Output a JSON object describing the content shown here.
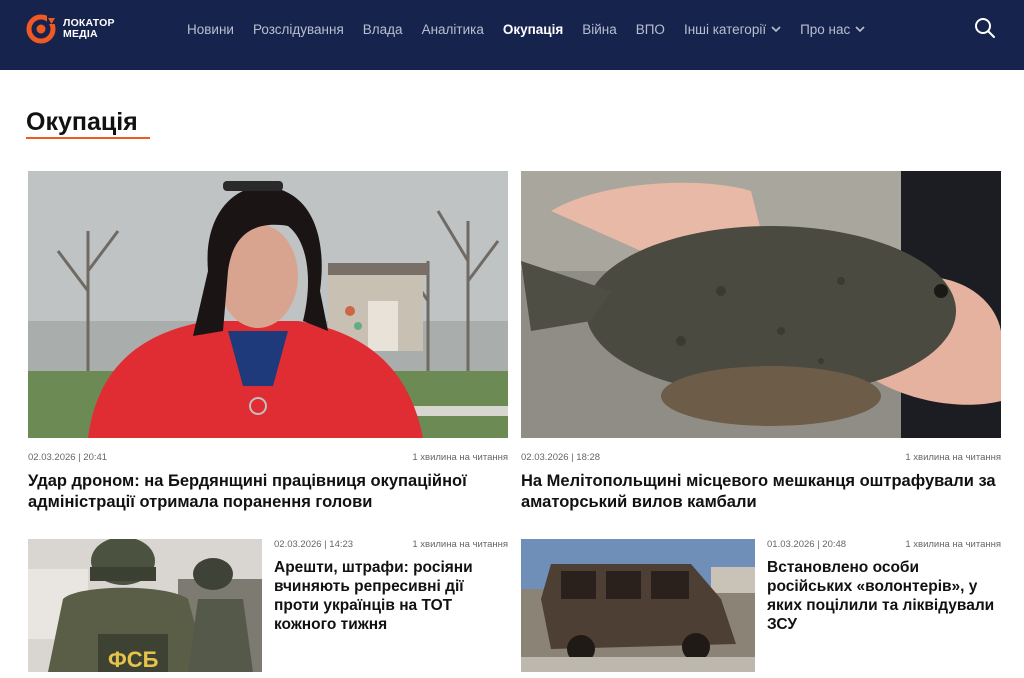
{
  "brand": {
    "line1": "ЛОКАТОР",
    "line2": "МЕДІА",
    "accent_color": "#f05a22",
    "header_color": "#16234d"
  },
  "nav": {
    "items": [
      {
        "label": "Новини"
      },
      {
        "label": "Розслідування"
      },
      {
        "label": "Влада"
      },
      {
        "label": "Аналітика"
      },
      {
        "label": "Окупація"
      },
      {
        "label": "Війна"
      },
      {
        "label": "ВПО"
      },
      {
        "label": "Інші категорії"
      },
      {
        "label": "Про нас"
      }
    ],
    "active": "Окупація",
    "search_icon": "search-icon"
  },
  "page": {
    "title": "Окупація"
  },
  "articles": [
    {
      "date": "02.03.2026 | 20:41",
      "read_time": "1 хвилина на читання",
      "title": "Удар дроном: на Бердянщині працівниця окупаційної адміністрації отримала поранення голови"
    },
    {
      "date": "02.03.2026 | 18:28",
      "read_time": "1 хвилина на читання",
      "title": "На Мелітопольщині місцевого мешканця оштрафували за аматорський вилов камбали"
    },
    {
      "date": "02.03.2026 | 14:23",
      "read_time": "1 хвилина на читання",
      "title": "Арешти, штрафи: росіяни вчиняють репресивні дії проти українців на ТОТ кожного тижня"
    },
    {
      "date": "01.03.2026 | 20:48",
      "read_time": "1 хвилина на читання",
      "title": "Встановлено особи російських «волонтерів», у яких поцілили та ліквідували ЗСУ"
    }
  ],
  "image_text": {
    "fsb_patch": "ФСБ"
  }
}
